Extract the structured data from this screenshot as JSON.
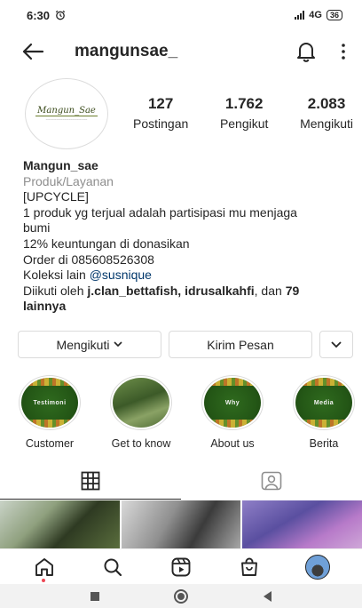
{
  "status_bar": {
    "time": "6:30",
    "network": "4G",
    "battery": "36"
  },
  "header": {
    "username": "mangunsae_"
  },
  "profile": {
    "avatar_logo_text": "Mangun_Sae",
    "stats": [
      {
        "value": "127",
        "label": "Postingan"
      },
      {
        "value": "1.762",
        "label": "Pengikut"
      },
      {
        "value": "2.083",
        "label": "Mengikuti"
      }
    ]
  },
  "bio": {
    "name": "Mangun_sae",
    "category": "Produk/Layanan",
    "lines": [
      "[UPCYCLE]",
      "1 produk yg terjual adalah partisipasi mu menjaga",
      "bumi",
      "12% keuntungan di donasikan",
      "Order di 085608526308"
    ],
    "collection_prefix": "Koleksi lain ",
    "collection_link": "@susnique",
    "followed_prefix": "Diikuti oleh ",
    "followed_names": "j.clan_bettafish, idrusalkahfi",
    "followed_middle": ", dan ",
    "followed_count": "79",
    "followed_suffix": "lainnya"
  },
  "actions": {
    "follow_label": "Mengikuti",
    "message_label": "Kirim Pesan"
  },
  "highlights": [
    {
      "inner_text": "Testimoni",
      "label": "Customer"
    },
    {
      "inner_text": "",
      "label": "Get to know"
    },
    {
      "inner_text": "Why",
      "label": "About us"
    },
    {
      "inner_text": "Media",
      "label": "Berita"
    }
  ],
  "icons": {
    "back": "back-arrow-icon",
    "notifications": "bell-icon",
    "menu": "more-vertical-icon",
    "grid_tab": "grid-icon",
    "tagged_tab": "tagged-person-icon",
    "nav": [
      "home-icon",
      "search-icon",
      "reels-icon",
      "shop-icon",
      "profile-avatar"
    ]
  },
  "colors": {
    "link": "#00376b",
    "muted": "#8e8e8e",
    "highlight_green": "#245716",
    "notification_dot": "#ed4956"
  }
}
